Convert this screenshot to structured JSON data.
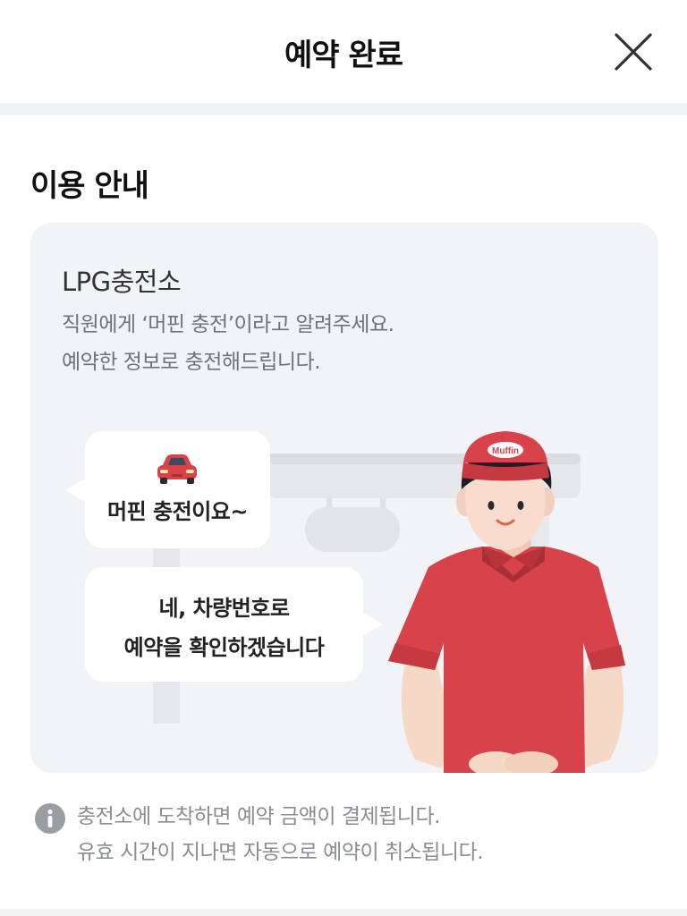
{
  "header": {
    "title": "예약 완료",
    "close_icon": "close-icon"
  },
  "section": {
    "title": "이용 안내"
  },
  "card": {
    "station_name": "LPG충전소",
    "description_lines": [
      "직원에게 ‘머핀 충전’이라고 알려주세요.",
      "예약한 정보로 충전해드립니다."
    ],
    "illustration": {
      "customer_bubble": {
        "icon": "car-icon",
        "text": "머핀 충전이요~"
      },
      "attendant_bubble": {
        "lines": [
          "네, 차량번호로",
          "예약을 확인하겠습니다"
        ]
      },
      "cap_logo_text": "Muffin"
    }
  },
  "notice": {
    "icon": "info-icon",
    "lines": [
      "충전소에 도착하면 예약 금액이 결제됩니다.",
      "유효 시간이 지나면 자동으로 예약이 취소됩니다."
    ]
  },
  "colors": {
    "uniform_red": "#d8424a",
    "card_bg": "#f2f3f6",
    "muted_text": "#8a8d93"
  }
}
